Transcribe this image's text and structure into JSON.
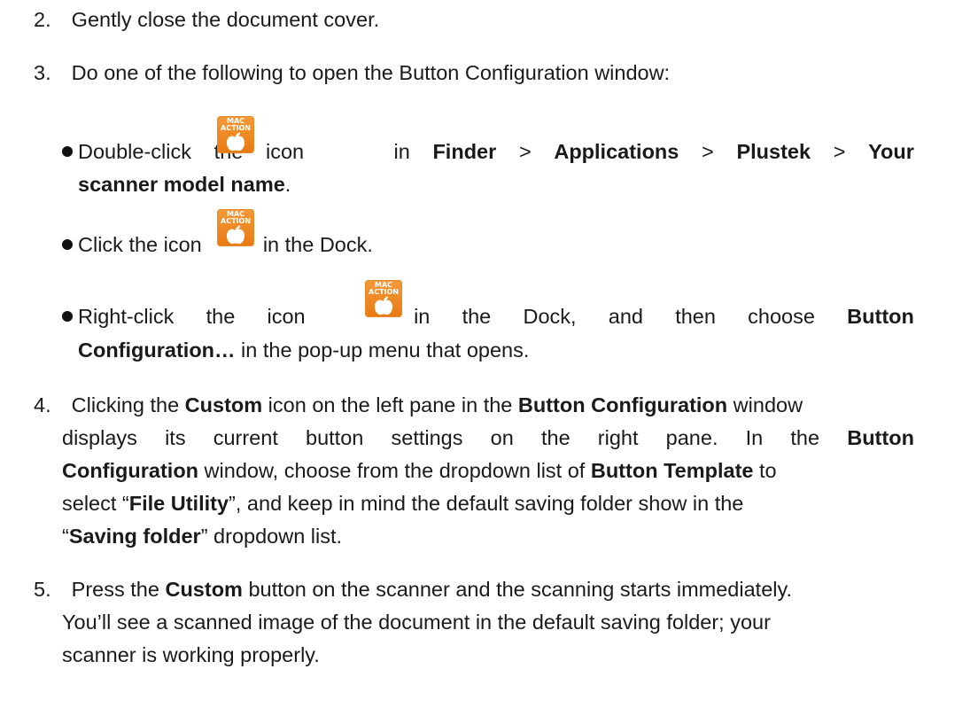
{
  "steps": {
    "s2": {
      "num": "2.",
      "text": "Gently close the document cover."
    },
    "s3": {
      "num": "3.",
      "text": "Do one of the following to open the Button Configuration window:",
      "bullets": {
        "b1": {
          "w1": "Double-click",
          "w2": "the",
          "w3": "icon",
          "w4": "in",
          "finder": "Finder",
          "gt": ">",
          "applications": "Applications",
          "plustek": "Plustek",
          "your": "Your",
          "model": "scanner model name",
          "period": "."
        },
        "b2": {
          "before": "Click the icon",
          "after": "in the Dock."
        },
        "b3": {
          "w1": "Right-click",
          "w2": "the",
          "w3": "icon",
          "w4": "in",
          "w5": "the",
          "w6": "Dock,",
          "w7": "and",
          "w8": "then",
          "w9": "choose",
          "w10": "Button",
          "bold2": "Configuration…",
          "rest": " in the pop-up menu that opens."
        }
      }
    },
    "s4": {
      "num": "4.",
      "l1": {
        "a": "Clicking the ",
        "b": "Custom",
        "c": " icon on the left pane in the ",
        "d": "Button Configuration",
        "e": " window"
      },
      "l2": {
        "w1": "displays",
        "w2": "its",
        "w3": "current",
        "w4": "button",
        "w5": "settings",
        "w6": "on",
        "w7": "the",
        "w8": "right",
        "w9": "pane.",
        "w10": "In",
        "w11": "the",
        "w12": "Button"
      },
      "l3": {
        "a": "Configuration",
        "b": " window, choose from the dropdown list of ",
        "c": "Button Template",
        "d": " to"
      },
      "l4": {
        "a": "select “",
        "b": "File Utility",
        "c": "”, and keep in mind the default saving folder show in the"
      },
      "l5": {
        "a": "“",
        "b": "Saving folder",
        "c": "” dropdown list."
      }
    },
    "s5": {
      "num": "5.",
      "l1": {
        "a": "Press the ",
        "b": "Custom",
        "c": " button on the scanner and the scanning starts immediately."
      },
      "l2": "You’ll see a scanned image of the document in the default saving folder; your",
      "l3": "scanner is working properly."
    }
  },
  "icon": {
    "label_top": "MAC",
    "label_bottom": "ACTION",
    "name": "mac-action-icon",
    "bg_color": "#ee8a26",
    "glyph_color": "#ffffff"
  }
}
